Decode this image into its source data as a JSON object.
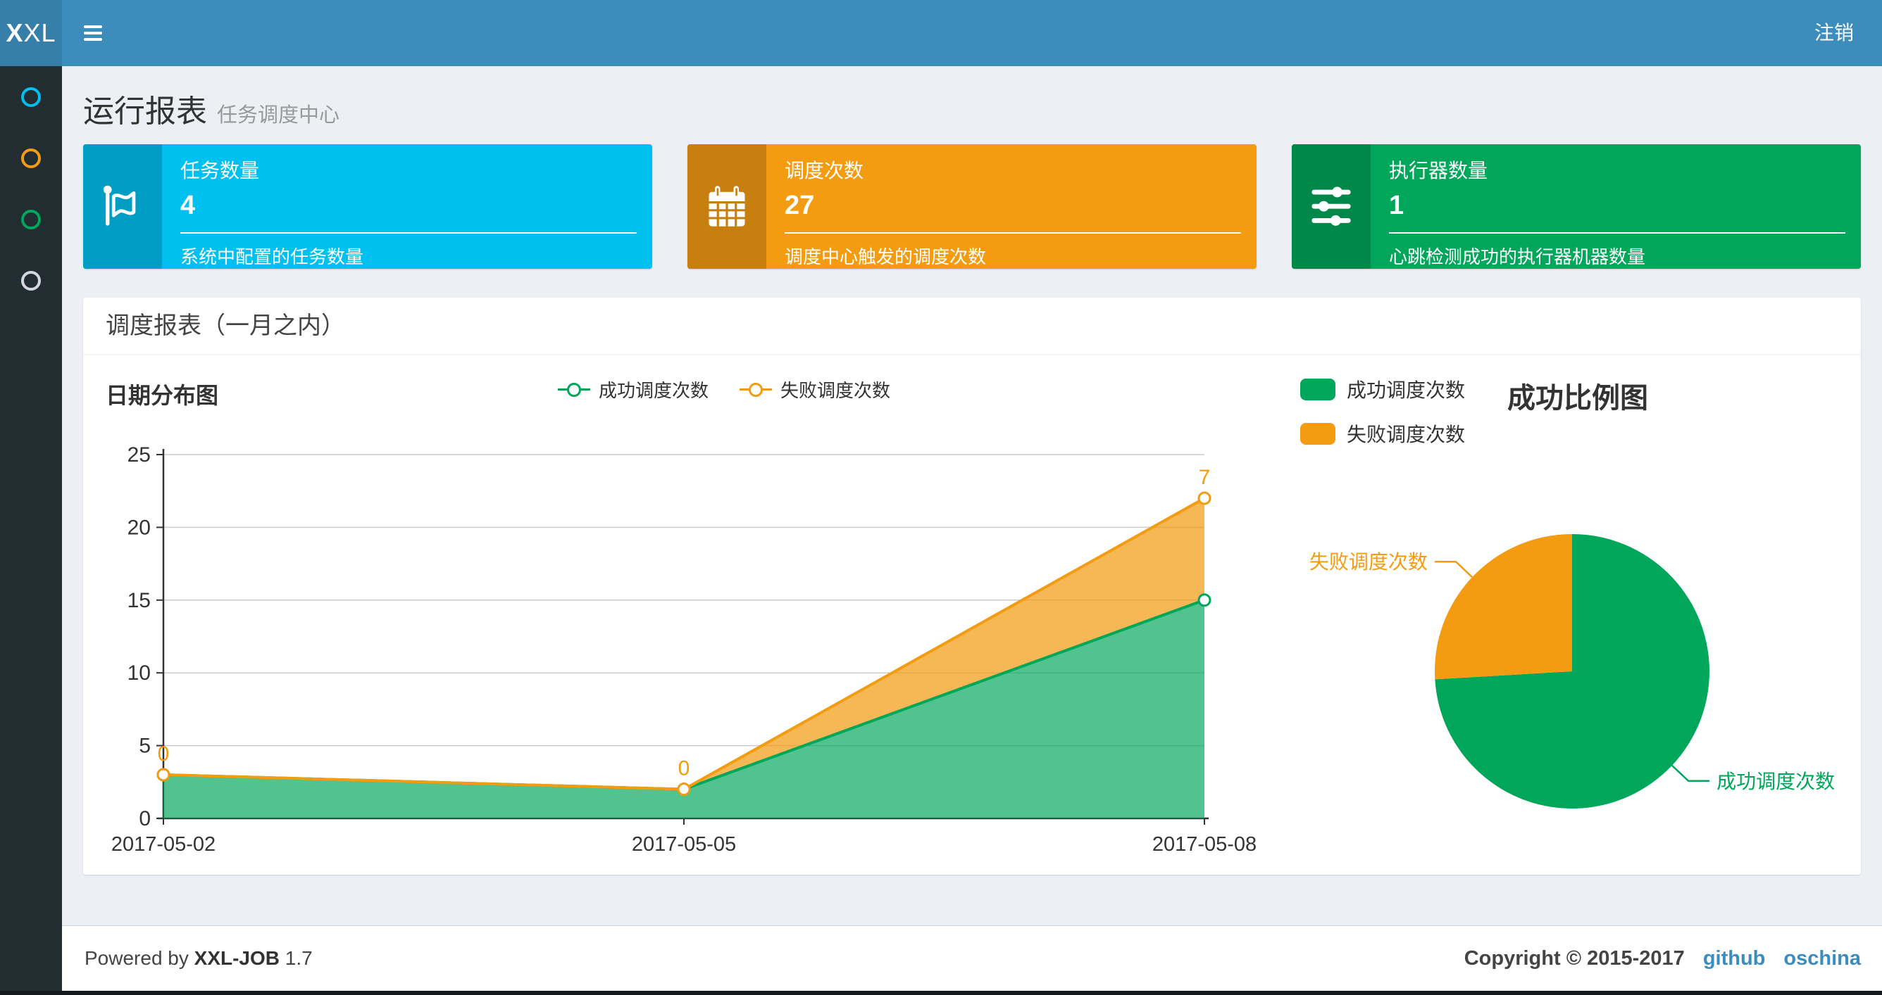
{
  "navbar": {
    "logo_bold": "X",
    "logo_light": "XL",
    "logout_label": "注销"
  },
  "sidebar": {
    "items": [
      {
        "icon": "circle-outline-icon",
        "color": "#00c0ef"
      },
      {
        "icon": "circle-outline-icon",
        "color": "#f39c12"
      },
      {
        "icon": "circle-outline-icon",
        "color": "#00a65a"
      },
      {
        "icon": "circle-outline-icon",
        "color": "#d2d6de"
      }
    ]
  },
  "header": {
    "title": "运行报表",
    "subtitle": "任务调度中心"
  },
  "stats": [
    {
      "label": "任务数量",
      "value": "4",
      "description": "系统中配置的任务数量",
      "color": "#00c0ef",
      "icon": "flag-icon"
    },
    {
      "label": "调度次数",
      "value": "27",
      "description": "调度中心触发的调度次数",
      "color": "#f39c12",
      "icon": "calendar-icon"
    },
    {
      "label": "执行器数量",
      "value": "1",
      "description": "心跳检测成功的执行器机器数量",
      "color": "#00a65a",
      "icon": "sliders-icon"
    }
  ],
  "panel": {
    "title": "调度报表（一月之内）"
  },
  "chart_data": [
    {
      "type": "area",
      "title": "日期分布图",
      "x": [
        "2017-05-02",
        "2017-05-05",
        "2017-05-08"
      ],
      "series": [
        {
          "name": "成功调度次数",
          "values": [
            3,
            2,
            15
          ],
          "color": "#00a65a",
          "fill": "rgba(0,166,90,0.68)"
        },
        {
          "name": "失败调度次数",
          "values": [
            0,
            0,
            7
          ],
          "color": "#f39c12",
          "fill": "rgba(243,156,18,0.72)",
          "point_labels": [
            "0",
            "0",
            "7"
          ]
        }
      ],
      "stacked": true,
      "ylim": [
        0,
        25
      ],
      "ytick_step": 5,
      "grid": true,
      "legend_position": "top-center",
      "axis_color": "#333333",
      "grid_color": "#cccccc"
    },
    {
      "type": "pie",
      "title": "成功比例图",
      "slices": [
        {
          "name": "成功调度次数",
          "value": 20,
          "color": "#00a65a"
        },
        {
          "name": "失败调度次数",
          "value": 7,
          "color": "#f39c12"
        }
      ],
      "start_angle": 90,
      "clockwise": true,
      "legend_position": "top-left"
    }
  ],
  "footer": {
    "powered_prefix": "Powered by",
    "product": "XXL-JOB",
    "version": "1.7",
    "copyright": "Copyright © 2015-2017",
    "links": [
      {
        "label": "github"
      },
      {
        "label": "oschina"
      }
    ]
  }
}
